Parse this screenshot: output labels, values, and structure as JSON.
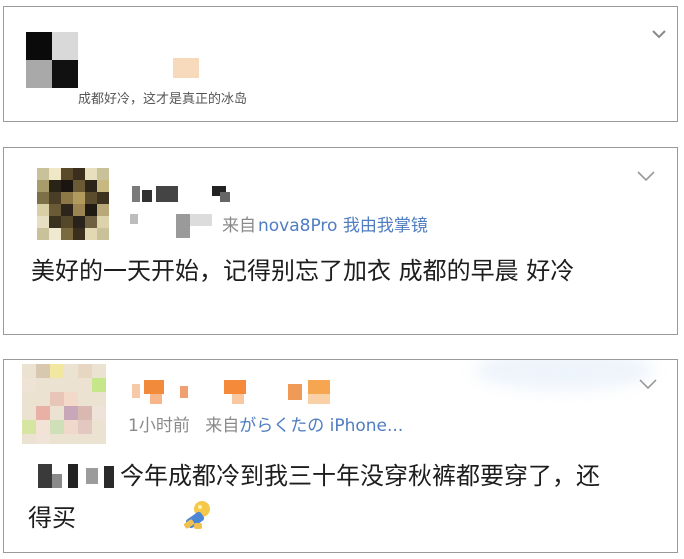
{
  "posts": [
    {
      "text": "成都好冷，这才是真正的冰岛"
    },
    {
      "meta_prefix": "来自",
      "meta_source": "nova8Pro 我由我掌镜",
      "text": "美好的一天开始，记得别忘了加衣 成都的早晨 好冷"
    },
    {
      "time": "1小时前",
      "meta_prefix": "来自",
      "meta_source": "がらくたの iPhone...",
      "text": "今年成都冷到我三十年没穿秋裤都要穿了，还得买"
    }
  ],
  "icons": {
    "menu": "chevron-down-icon",
    "emoji": "emoji-icon"
  }
}
